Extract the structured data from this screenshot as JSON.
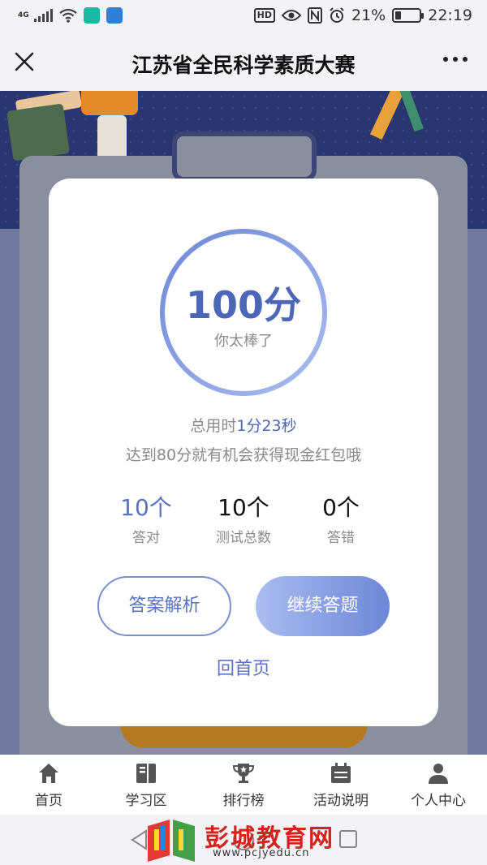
{
  "status_bar": {
    "network": "4G",
    "battery_percent": "21%",
    "time": "22:19",
    "battery_level": 0.21,
    "icons": [
      "signal-icon",
      "wifi-icon",
      "home-app-icon",
      "app-icon",
      "hd-icon",
      "eye-icon",
      "nfc-icon",
      "alarm-icon",
      "battery-icon"
    ]
  },
  "header": {
    "title": "江苏省全民科学素质大赛"
  },
  "result": {
    "score": "100分",
    "praise": "你太棒了",
    "time_label": "总用时",
    "time_value": "1分23秒",
    "tip": "达到80分就有机会获得现金红包哦",
    "stats": [
      {
        "value": "10个",
        "label": "答对"
      },
      {
        "value": "10个",
        "label": "测试总数"
      },
      {
        "value": "0个",
        "label": "答错"
      }
    ],
    "btn_review": "答案解析",
    "btn_continue": "继续答题",
    "home_link": "回首页"
  },
  "tabs": [
    {
      "label": "首页",
      "icon": "home-icon"
    },
    {
      "label": "学习区",
      "icon": "book-icon"
    },
    {
      "label": "排行榜",
      "icon": "trophy-icon"
    },
    {
      "label": "活动说明",
      "icon": "calendar-icon"
    },
    {
      "label": "个人中心",
      "icon": "person-icon"
    }
  ],
  "watermark": {
    "name": "彭城教育网",
    "url": "www.pcjyedu.cn"
  },
  "colors": {
    "accent": "#4c66b8",
    "button_gradient_start": "#a9bdf0",
    "button_gradient_end": "#6e86d7",
    "background_dark": "#2a3670"
  }
}
